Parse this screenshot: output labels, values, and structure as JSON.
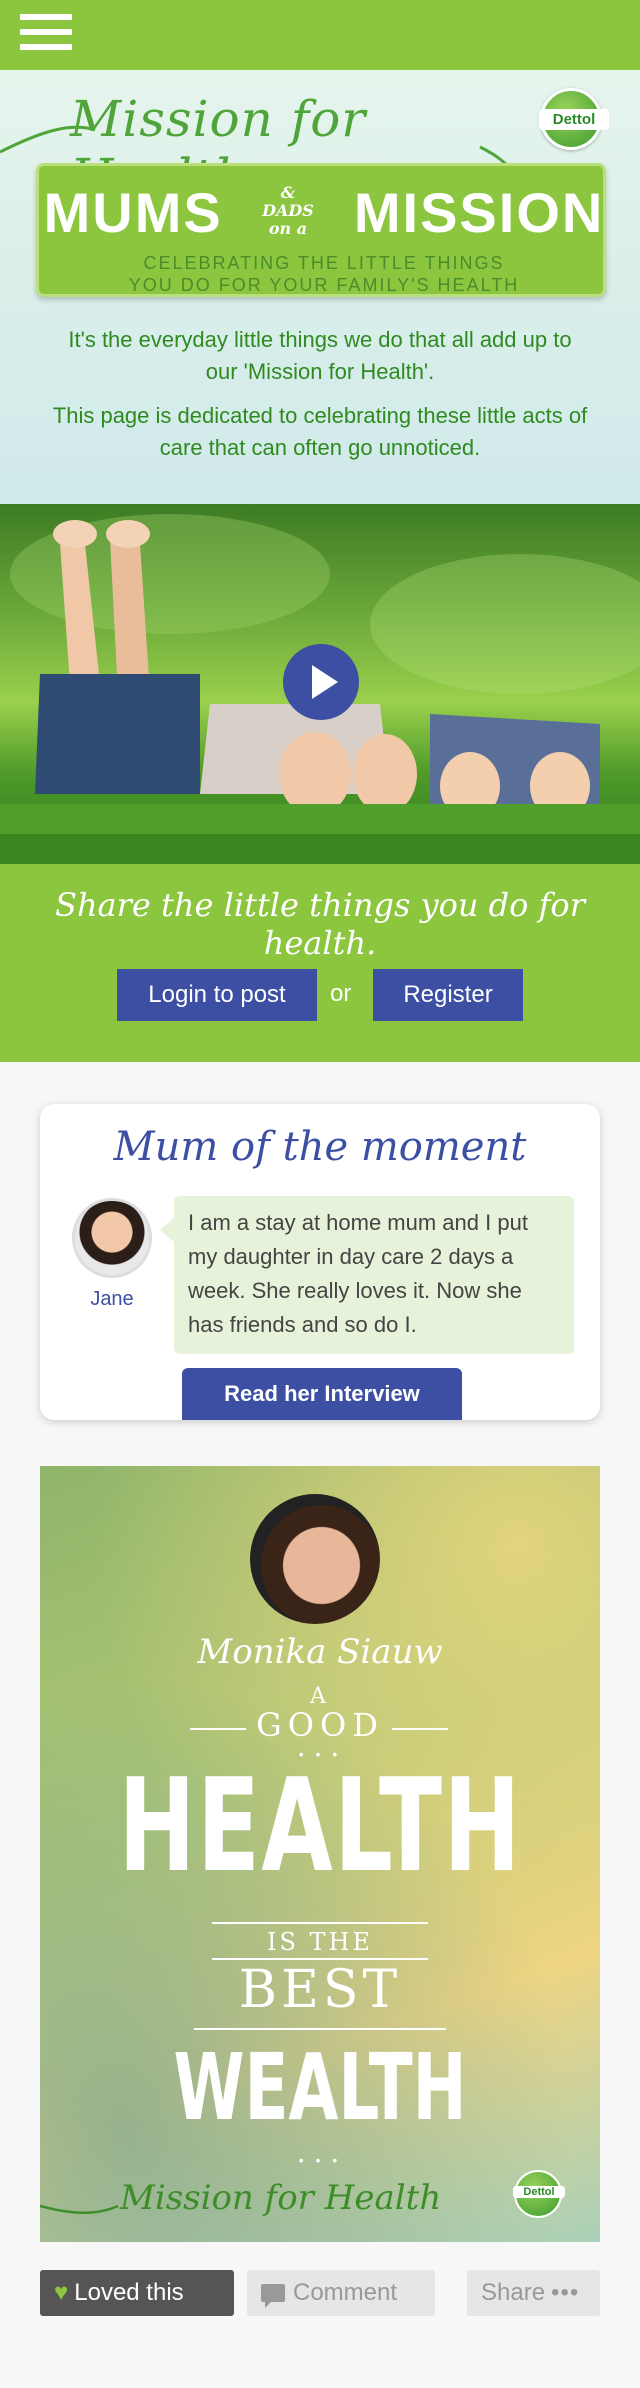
{
  "nav": {
    "menu_icon": "hamburger-menu-icon"
  },
  "hero": {
    "script_title": "Mission for Health",
    "logo_text": "Dettol",
    "badge": {
      "title_left": "MUMS",
      "title_small": "& DADS on a",
      "title_right": "MISSION",
      "subtitle_line1": "CELEBRATING THE LITTLE THINGS",
      "subtitle_line2": "YOU DO FOR YOUR FAMILY'S HEALTH"
    },
    "intro1": "It's the everyday little things we do that all add up to our 'Mission for Health'.",
    "intro2": "This page is dedicated to celebrating these little acts of care that can often go unnoticed."
  },
  "video": {
    "play_icon": "play-icon"
  },
  "share": {
    "tagline": "Share the little things you do for health.",
    "login_label": "Login to post",
    "or_label": "or",
    "register_label": "Register"
  },
  "mom_of_moment": {
    "title": "Mum of the moment",
    "name": "Jane",
    "quote": "I am a stay at home mum and I put my daughter in day care 2 days a week. She really loves it. Now she has friends and so do I.",
    "button_label": "Read her Interview"
  },
  "poster": {
    "name": "Monika Siauw",
    "line_a": "A",
    "line_good": "GOOD",
    "line_health": "HEALTH",
    "line_isthe": "IS THE",
    "line_best": "BEST",
    "line_wealth": "WEALTH",
    "footer_script": "Mission for Health",
    "logo_text": "Dettol"
  },
  "actions": {
    "loved_label": "Loved this",
    "comment_label": "Comment",
    "share_label": "Share",
    "share_dots": "•••"
  },
  "colors": {
    "brand_green": "#8cc63f",
    "brand_blue": "#3d4fa3"
  }
}
